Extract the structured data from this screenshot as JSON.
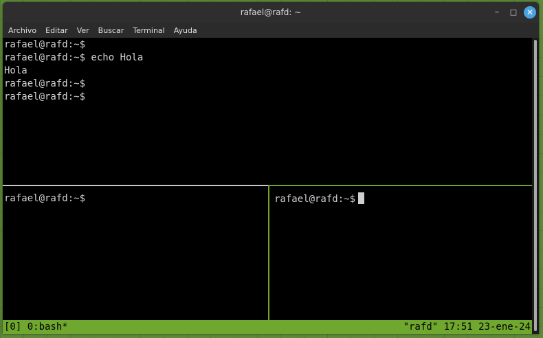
{
  "window": {
    "title": "rafael@rafd: ~"
  },
  "controls": {
    "minimize": "–",
    "maximize": "□",
    "close": "✕"
  },
  "menu": [
    "Archivo",
    "Editar",
    "Ver",
    "Buscar",
    "Terminal",
    "Ayuda"
  ],
  "panes": {
    "top": [
      "rafael@rafd:~$",
      "rafael@rafd:~$ echo Hola",
      "Hola",
      "rafael@rafd:~$",
      "rafael@rafd:~$"
    ],
    "bottom_left": [
      "rafael@rafd:~$"
    ],
    "bottom_right": [
      "rafael@rafd:~$"
    ]
  },
  "statusbar": {
    "left": "[0] 0:bash*",
    "right": "\"rafd\" 17:51 23-ene-24"
  },
  "colors": {
    "accent_green": "#70a72e",
    "close_blue": "#4aa3e0",
    "terminal_bg": "#000000"
  }
}
